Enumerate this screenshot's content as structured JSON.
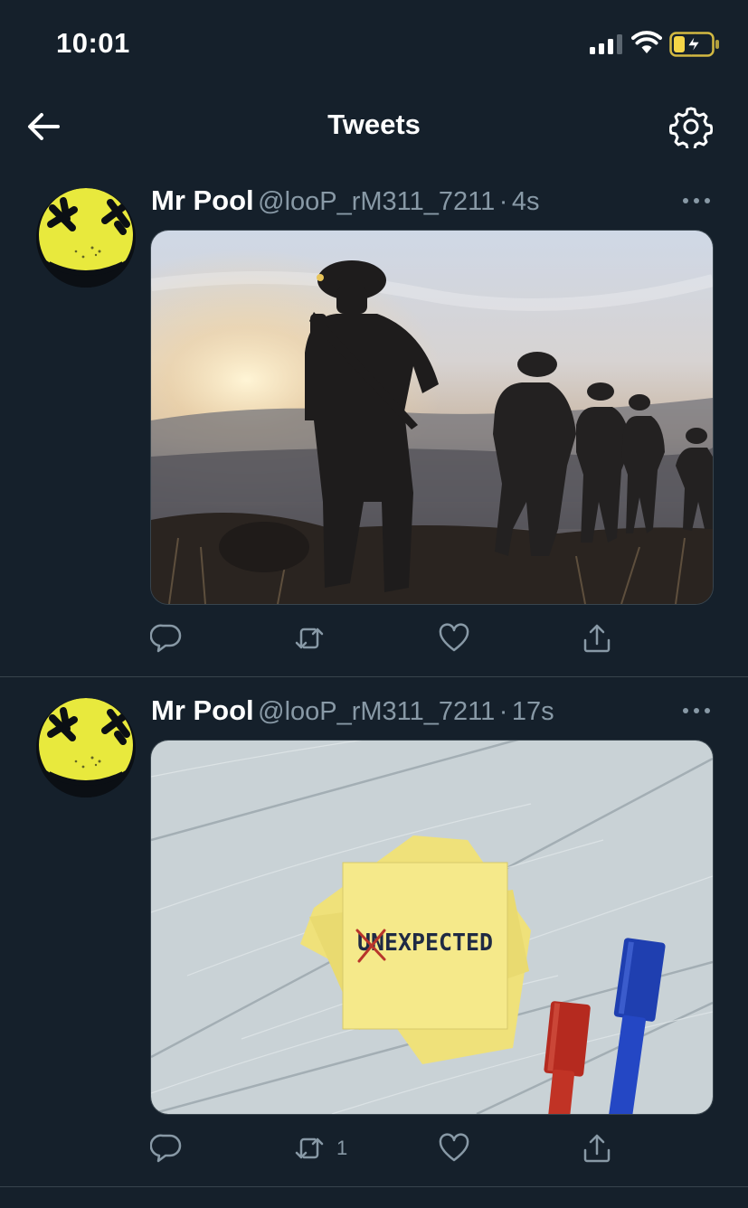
{
  "status_bar": {
    "time": "10:01"
  },
  "nav": {
    "title": "Tweets"
  },
  "colors": {
    "background": "#15202b",
    "secondary_text": "#8899a6",
    "divider": "#38444d",
    "avatar_yellow": "#e8e93d",
    "battery_yellow": "#f5d547"
  },
  "icons": {
    "back": "arrow-left-icon",
    "settings": "gear-icon",
    "more": "more-horizontal-icon",
    "reply": "reply-icon",
    "retweet": "retweet-icon",
    "like": "heart-icon",
    "share": "share-icon"
  },
  "tweets": [
    {
      "display_name": "Mr Pool",
      "handle": "@looP_rM311_7211",
      "separator": "·",
      "time_ago": "4s",
      "retweet_count": ""
    },
    {
      "display_name": "Mr Pool",
      "handle": "@looP_rM311_7211",
      "separator": "·",
      "time_ago": "17s",
      "retweet_count": "1",
      "image_text": "UNEXPECTED"
    }
  ]
}
